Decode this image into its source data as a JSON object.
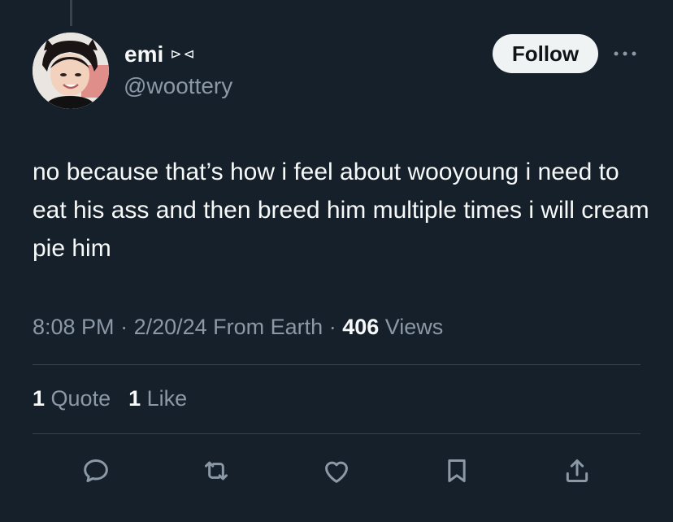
{
  "author": {
    "display_name": "emi",
    "name_emoji": "⊳⊲",
    "handle": "@woottery"
  },
  "header": {
    "follow_label": "Follow"
  },
  "tweet": {
    "text": "no because that’s how i feel about wooyoung i need to eat his ass and then breed him multiple times i will cream pie him"
  },
  "meta": {
    "time": "8:08 PM",
    "sep1": " · ",
    "date": "2/20/24",
    "source": " From Earth",
    "sep2": " · ",
    "views_count": "406",
    "views_label": " Views"
  },
  "stats": {
    "quotes_count": "1",
    "quotes_label": " Quote",
    "likes_count": "1",
    "likes_label": " Like"
  },
  "actions": [
    "reply-icon",
    "retweet-icon",
    "like-icon",
    "bookmark-icon",
    "share-icon"
  ],
  "colors": {
    "background": "#15202b",
    "text": "#f7f9f9",
    "secondary": "#8b98a5",
    "divider": "#38444d",
    "follow_bg": "#eff3f4"
  }
}
